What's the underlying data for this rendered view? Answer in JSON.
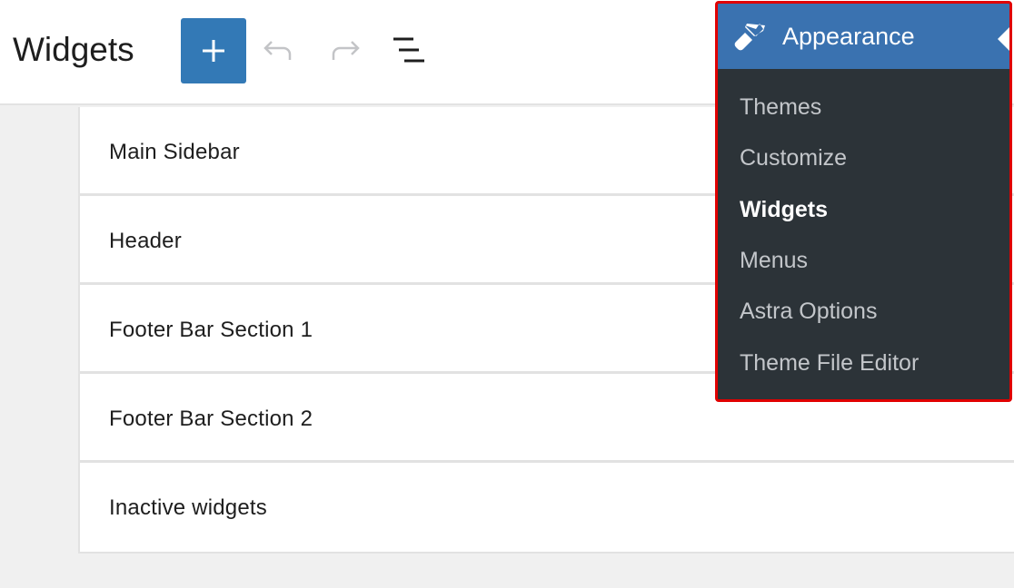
{
  "header": {
    "title": "Widgets",
    "add_block_label": "Add block",
    "undo_label": "Undo",
    "redo_label": "Redo",
    "list_view_label": "List view"
  },
  "widget_areas": [
    {
      "label": "Main Sidebar"
    },
    {
      "label": "Header"
    },
    {
      "label": "Footer Bar Section 1"
    },
    {
      "label": "Footer Bar Section 2"
    },
    {
      "label": "Inactive widgets"
    }
  ],
  "admin_menu": {
    "section": "Appearance",
    "icon": "paintbrush-icon",
    "highlight_color": "#e00000",
    "items": [
      {
        "label": "Themes",
        "current": false
      },
      {
        "label": "Customize",
        "current": false
      },
      {
        "label": "Widgets",
        "current": true
      },
      {
        "label": "Menus",
        "current": false
      },
      {
        "label": "Astra Options",
        "current": false
      },
      {
        "label": "Theme File Editor",
        "current": false
      }
    ]
  }
}
